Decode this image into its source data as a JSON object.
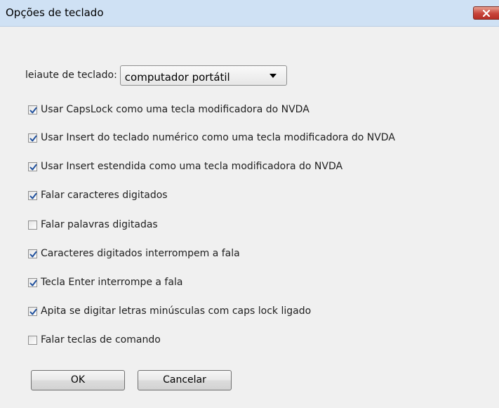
{
  "window": {
    "title": "Opções de teclado"
  },
  "keyboard_layout": {
    "label": "leiaute de teclado:",
    "selected": "computador portátil"
  },
  "options": [
    {
      "label": "Usar CapsLock como uma tecla modificadora do NVDA",
      "checked": true
    },
    {
      "label": "Usar Insert do teclado numérico como uma tecla modificadora do NVDA",
      "checked": true
    },
    {
      "label": "Usar Insert estendida como uma tecla modificadora do NVDA",
      "checked": true
    },
    {
      "label": "Falar caracteres digitados",
      "checked": true
    },
    {
      "label": "Falar palavras digitadas",
      "checked": false
    },
    {
      "label": "Caracteres digitados interrompem a fala",
      "checked": true
    },
    {
      "label": "Tecla Enter interrompe a fala",
      "checked": true
    },
    {
      "label": "Apita se digitar letras minúsculas com caps lock ligado",
      "checked": true
    },
    {
      "label": "Falar teclas de comando",
      "checked": false
    }
  ],
  "buttons": {
    "ok": "OK",
    "cancel": "Cancelar"
  },
  "colors": {
    "title_bar": "#cfe1f4",
    "dialog_background": "#f0f0f0",
    "check_mark": "#1e4f9c",
    "close_button": "#c7443a"
  }
}
